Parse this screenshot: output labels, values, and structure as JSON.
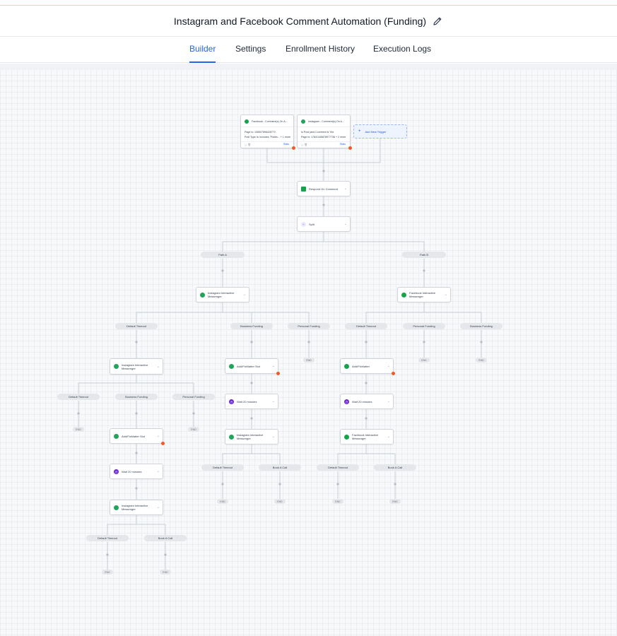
{
  "header": {
    "title": "Instagram and Facebook Comment Automation (Funding)",
    "edit_icon": "pencil-icon"
  },
  "tabs": [
    {
      "label": "Builder",
      "active": true
    },
    {
      "label": "Settings",
      "active": false
    },
    {
      "label": "Enrollment History",
      "active": false
    },
    {
      "label": "Execution Logs",
      "active": false
    }
  ],
  "colors": {
    "accent": "#2563eb",
    "alert_dot": "#f05a28",
    "instagram_icon": "#22a55b",
    "facebook_icon": "#16a34a",
    "wait_icon": "#6d28d9",
    "split_icon": "#8b5cf6"
  },
  "triggers": [
    {
      "title": "Facebook - Comment(s) On A...",
      "line1": "Page is: 106507896428772",
      "line2": "Post Type is: includes \"Publis...",
      "more": "+ 1 more",
      "stats": "Stats",
      "icon": "facebook-icon"
    },
    {
      "title": "Instagram - Comment(s) On A...",
      "line1": "Is Post (and Comment is Yes",
      "line2": "Page is: 17841446878977736",
      "more": "+ 2 more",
      "stats": "Stats",
      "icon": "instagram-icon"
    }
  ],
  "add_trigger": {
    "label": "Add New Trigger",
    "icon": "plus-icon"
  },
  "actions": {
    "respond": "Respond On Comment",
    "split": "Split",
    "ig_messenger": "Instagram Interactive Messenger",
    "fb_messenger": "Facebook Interactive Messenger",
    "add_tag_ig": "Add/FixMatter Slot",
    "add_tag_fb": "Add/FixMatter Slot",
    "add_tag_fb_right": "Add/FixMatter",
    "wait": "Wait 20 minutes"
  },
  "branches": {
    "path_a": "Path A",
    "path_b": "Path B",
    "default_timeout": "Default Timeout",
    "business_funding": "Business Funding",
    "personal_funding": "Personal Funding",
    "book_a_call": "Book A Call"
  },
  "end_label": "END"
}
